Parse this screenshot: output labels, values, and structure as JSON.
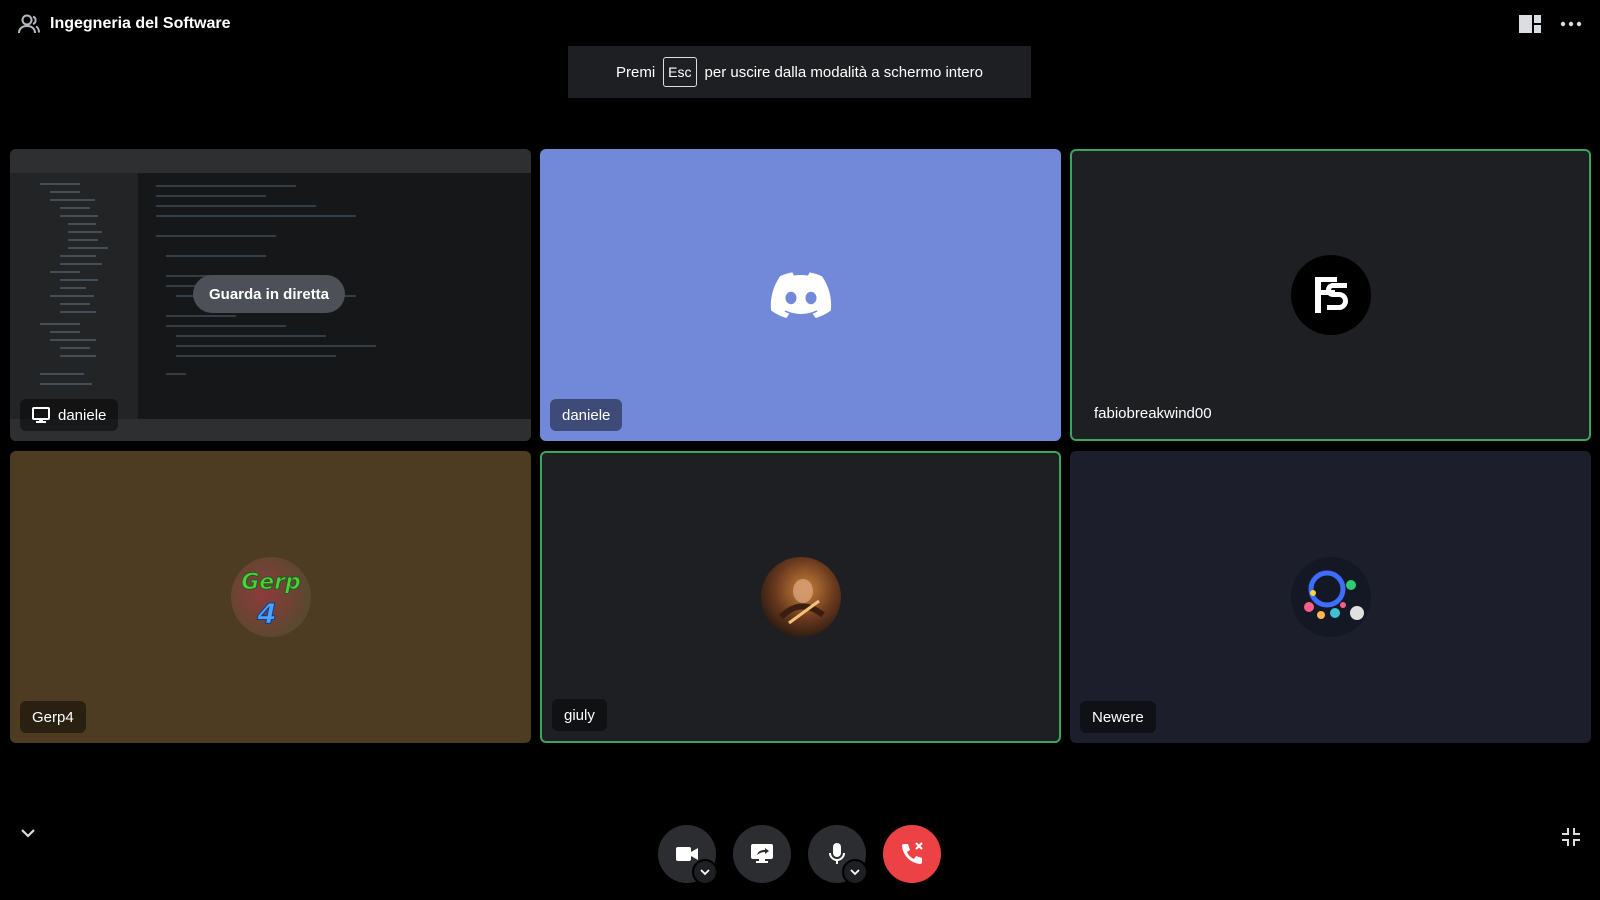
{
  "header": {
    "channel_name": "Ingegneria del Software"
  },
  "banner": {
    "prefix": "Premi",
    "key": "Esc",
    "suffix": "per uscire dalla modalità a schermo intero"
  },
  "tiles": [
    {
      "name": "daniele",
      "type": "screen-share",
      "action_label": "Guarda in diretta",
      "bg": "#2b2d30",
      "speaking": false
    },
    {
      "name": "daniele",
      "type": "default-avatar",
      "bg": "#7289da",
      "speaking": false
    },
    {
      "name": "fabiobreakwind00",
      "type": "avatar",
      "bg": "#1e1f22",
      "speaking": true
    },
    {
      "name": "Gerp4",
      "type": "avatar",
      "bg": "#4d3b22",
      "speaking": false
    },
    {
      "name": "giuly",
      "type": "avatar",
      "bg": "#1e1f22",
      "speaking": true
    },
    {
      "name": "Newere",
      "type": "avatar",
      "bg": "#1c1f2b",
      "speaking": false
    }
  ],
  "avatar_text": {
    "gerp_line1": "Gerp",
    "gerp_line2": "4"
  },
  "controls": [
    {
      "icon": "camera-icon"
    },
    {
      "icon": "screen-share-icon"
    },
    {
      "icon": "microphone-icon"
    },
    {
      "icon": "hang-up-icon"
    }
  ],
  "colors": {
    "speaking_border": "#3ba55d",
    "hangup": "#ed4245",
    "discord_blurple": "#7289da"
  }
}
